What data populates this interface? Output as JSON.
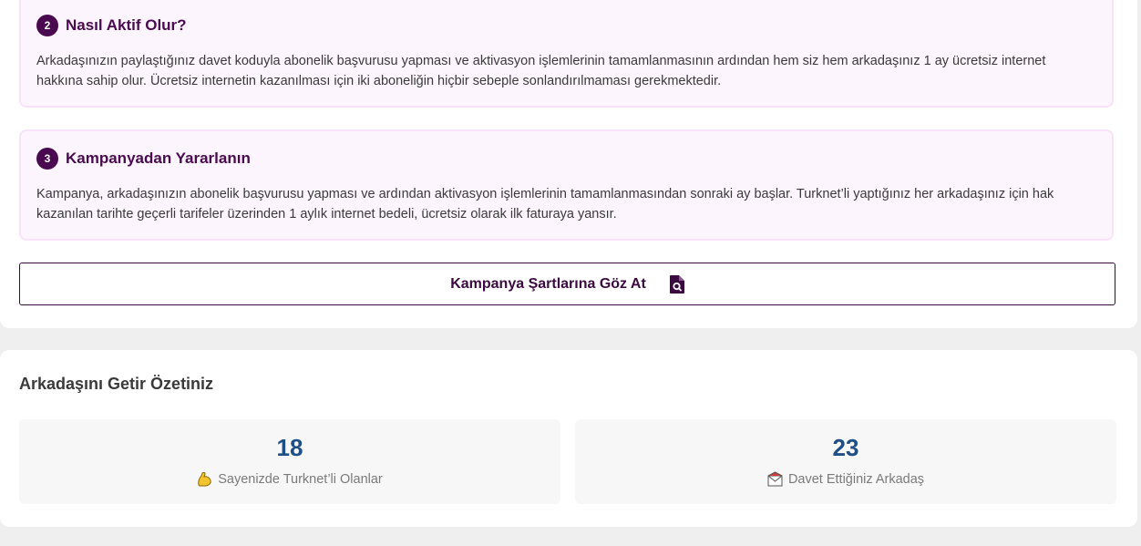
{
  "steps": [
    {
      "number": "2",
      "title": "Nasıl Aktif Olur?",
      "body": "Arkadaşınızın paylaştığınız davet koduyla abonelik başvurusu yapması ve aktivasyon işlemlerinin tamamlanmasının ardından hem siz hem arkadaşınız 1 ay ücretsiz internet hakkına sahip olur. Ücretsiz internetin kazanılması için iki aboneliğin hiçbir sebeple sonlandırılmaması gerekmektedir."
    },
    {
      "number": "3",
      "title": "Kampanyadan Yararlanın",
      "body": "Kampanya, arkadaşınızın abonelik başvurusu yapması ve ardından aktivasyon işlemlerinin tamamlanmasından sonraki ay başlar. Turknet’li yaptığınız her arkadaşınız için hak kazanılan tarihte geçerli tarifeler üzerinden 1 aylık internet bedeli, ücretsiz olarak ilk faturaya yansır."
    }
  ],
  "terms_button": {
    "label": "Kampanya Şartlarına Göz At",
    "icon": "document-search-icon"
  },
  "summary": {
    "title": "Arkadaşını Getir Özetiniz",
    "stats": [
      {
        "value": "18",
        "label": "Sayenizde Turknet’li Olanlar",
        "icon": "flexed-biceps-icon"
      },
      {
        "value": "23",
        "label": "Davet Ettiğiniz Arkadaş",
        "icon": "envelope-icon"
      }
    ]
  },
  "colors": {
    "brand": "#4a0a4f",
    "step_bg": "#fdf5fd",
    "stat_value": "#1e4f86"
  }
}
